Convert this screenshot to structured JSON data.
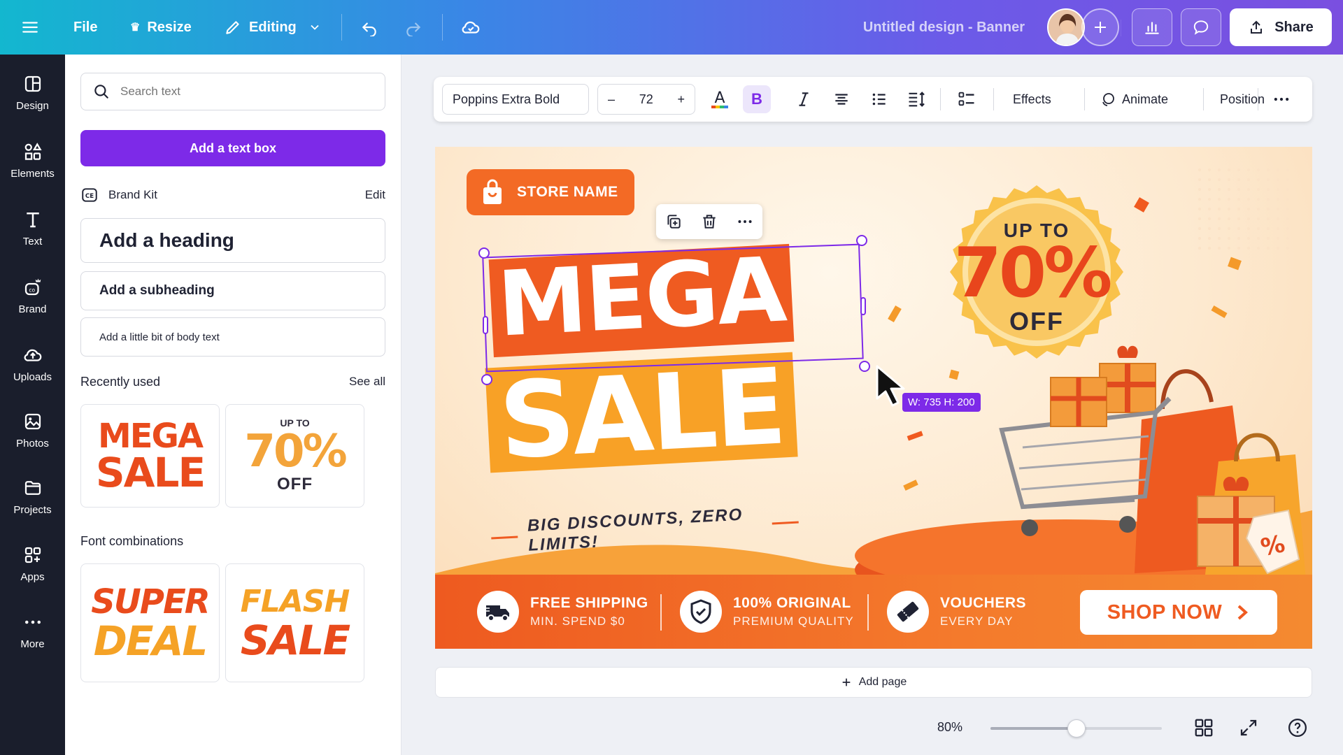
{
  "topbar": {
    "file_label": "File",
    "resize_label": "Resize",
    "editing_label": "Editing",
    "design_title": "Untitled design - Banner",
    "share_label": "Share"
  },
  "rail": {
    "items": [
      {
        "label": "Design",
        "icon": "design-icon"
      },
      {
        "label": "Elements",
        "icon": "elements-icon"
      },
      {
        "label": "Text",
        "icon": "text-icon"
      },
      {
        "label": "Brand",
        "icon": "brand-icon"
      },
      {
        "label": "Uploads",
        "icon": "uploads-icon"
      },
      {
        "label": "Photos",
        "icon": "photos-icon"
      },
      {
        "label": "Projects",
        "icon": "projects-icon"
      },
      {
        "label": "Apps",
        "icon": "apps-icon"
      },
      {
        "label": "More",
        "icon": "more-icon"
      }
    ]
  },
  "panel": {
    "search_placeholder": "Search text",
    "add_textbox": "Add a text box",
    "brand_kit": "Brand Kit",
    "brand_edit": "Edit",
    "add_heading": "Add a heading",
    "add_subheading": "Add a subheading",
    "add_body": "Add a little bit of body text",
    "recently_used": "Recently used",
    "see_all": "See all",
    "recent": [
      {
        "line1": "MEGA",
        "line2": "SALE"
      },
      {
        "line1": "UP TO",
        "line2": "70%",
        "line3": "OFF"
      }
    ],
    "font_combinations": "Font combinations",
    "combos": [
      {
        "line1": "SUPER",
        "line2": "DEAL"
      },
      {
        "line1": "FLASH",
        "line2": "SALE"
      }
    ]
  },
  "toolbar": {
    "font": "Poppins Extra Bold",
    "size": "72",
    "minus": "–",
    "plus": "+",
    "bold": "B",
    "effects": "Effects",
    "animate": "Animate",
    "position": "Position"
  },
  "canvas": {
    "store_name": "STORE NAME",
    "mega": "MEGA",
    "sale": "SALE",
    "tagline": "BIG DISCOUNTS, ZERO LIMITS!",
    "badge": {
      "up_to": "UP TO",
      "percent": "70%",
      "off": "OFF"
    },
    "dims_label": "W: 735 H: 200",
    "features": [
      {
        "title": "FREE SHIPPING",
        "sub": "MIN. SPEND $0",
        "icon": "truck-icon"
      },
      {
        "title": "100% ORIGINAL",
        "sub": "PREMIUM QUALITY",
        "icon": "shield-icon"
      },
      {
        "title": "VOUCHERS",
        "sub": "EVERY DAY",
        "icon": "ticket-icon"
      }
    ],
    "shop_now": "SHOP NOW",
    "tag_symbol": "%"
  },
  "bottom": {
    "add_page": "Add page",
    "zoom": "80%",
    "zoom_value": 0.5
  },
  "colors": {
    "accent": "#7d2ae8",
    "orange": "#ef5b21",
    "amber": "#f8a126"
  }
}
